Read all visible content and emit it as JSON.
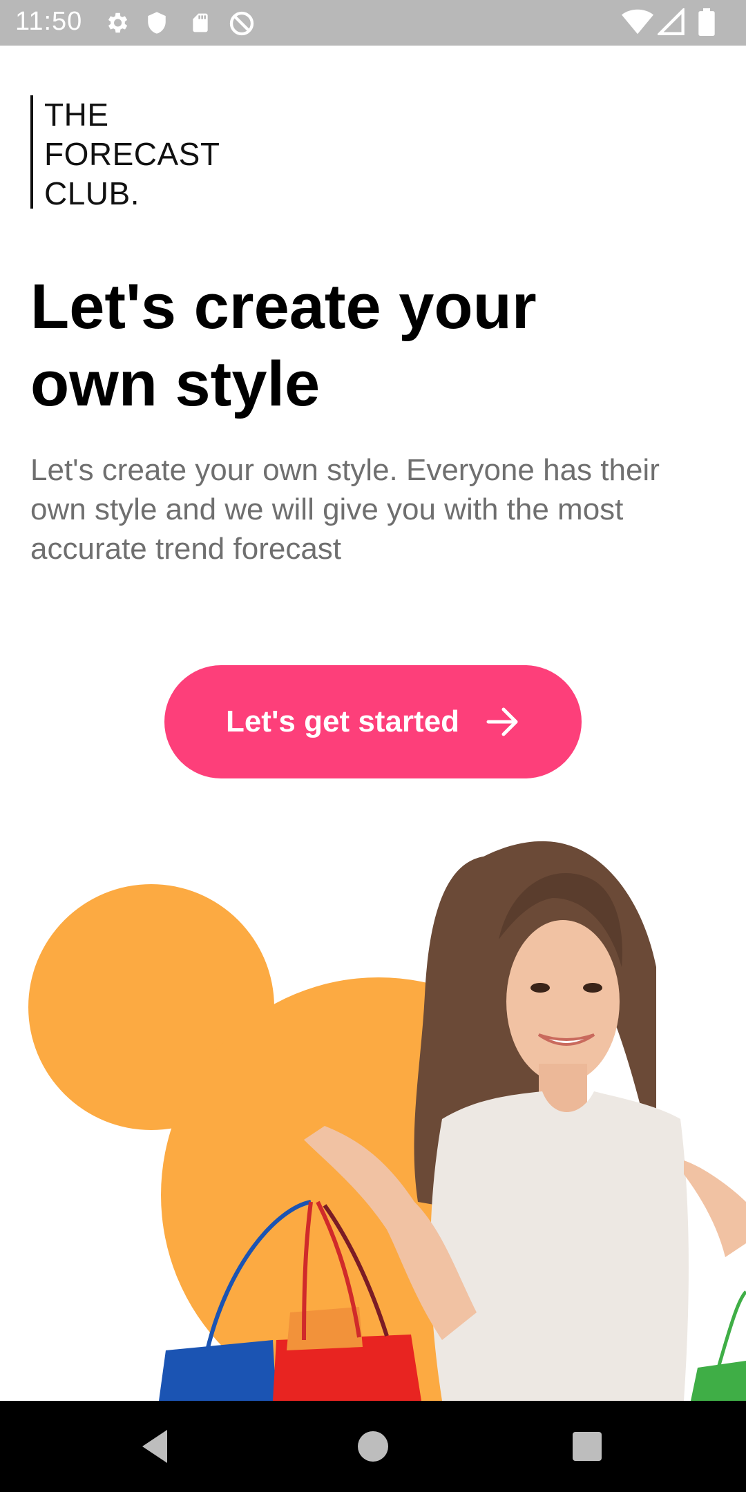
{
  "status_bar": {
    "time": "11:50",
    "left_icons": [
      "settings-icon",
      "shield-icon",
      "sd-card-icon",
      "do-not-disturb-icon"
    ],
    "right_icons": [
      "wifi-icon",
      "signal-icon",
      "battery-icon"
    ]
  },
  "logo": {
    "line1": "THE",
    "line2": "FORECAST",
    "line3": "CLUB."
  },
  "headline": {
    "line1": "Let's create your",
    "line2": "own style"
  },
  "description": "Let's create your own style. Everyone has their own style and we will give you with the most accurate trend forecast",
  "cta": {
    "label": "Let's get started",
    "icon": "arrow-right-icon"
  },
  "hero": {
    "subject": "smiling-woman-with-shopping-bags",
    "accent_color": "#fcaa42"
  },
  "nav_bar": {
    "buttons": [
      "back-icon",
      "home-icon",
      "recents-icon"
    ]
  },
  "colors": {
    "primary": "#fd3f7a",
    "accent": "#fcaa42",
    "status_bar": "#b8b8b8",
    "text_secondary": "#6f6f6f"
  }
}
